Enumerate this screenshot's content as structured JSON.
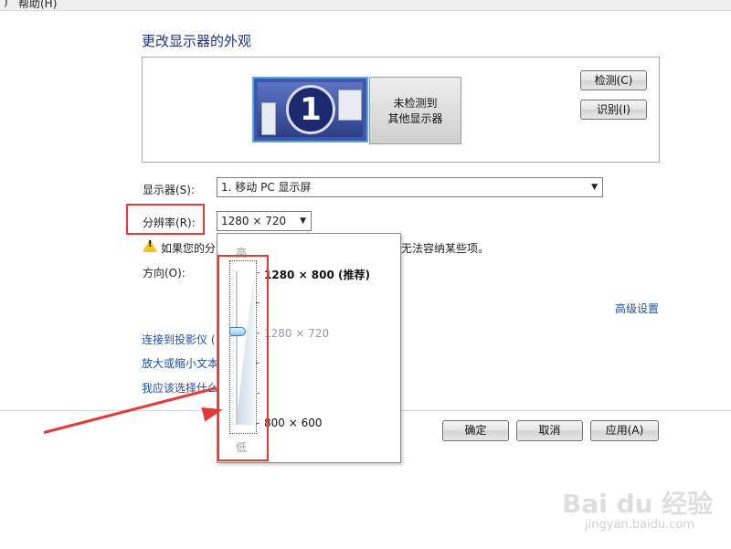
{
  "menu": {
    "edge": ")",
    "help": "帮助(H)"
  },
  "page_title": "更改显示器的外观",
  "monitors": {
    "primary_number": "1",
    "secondary_line1": "未检测到",
    "secondary_line2": "其他显示器"
  },
  "buttons": {
    "detect": "检测(C)",
    "identify": "识别(I)",
    "ok": "确定",
    "cancel": "取消",
    "apply": "应用(A)"
  },
  "fields": {
    "display_label": "显示器(S):",
    "display_value": "1. 移动 PC 显示屏",
    "resolution_label": "分辨率(R):",
    "resolution_value": "1280 × 720",
    "orientation_label": "方向(O):"
  },
  "warning": {
    "text_left": "如果您的分",
    "text_right": "无法容纳某些项。"
  },
  "links": {
    "advanced": "高级设置",
    "projector": "连接到投影仪 (",
    "text_size": "放大或缩小文本",
    "which": "我应该选择什么"
  },
  "resolution_popup": {
    "high": "高",
    "low": "低",
    "options": [
      {
        "label": "1280 × 800 (推荐)"
      },
      {
        "label": "1280 × 720"
      },
      {
        "label": "800 × 600"
      }
    ],
    "selected_index": 1
  },
  "watermark": {
    "brand": "Bai du 经验",
    "url": "jingyan.baidu.com"
  },
  "colors": {
    "title": "#1e3287",
    "link": "#1e4fa8",
    "highlight": "#e53935",
    "accent": "#59a5e0"
  }
}
